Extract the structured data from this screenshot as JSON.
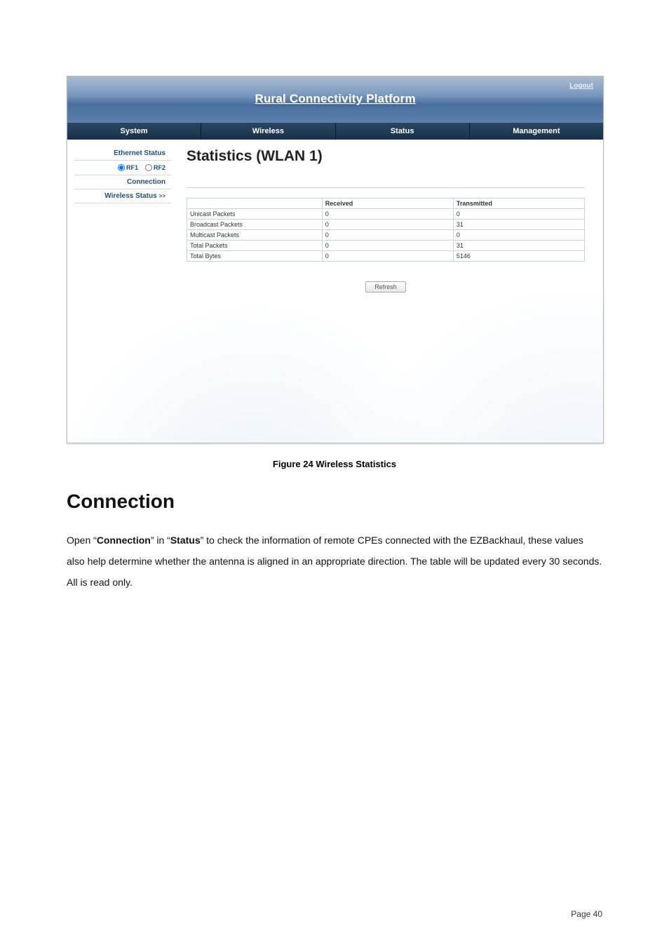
{
  "banner": {
    "title": "Rural Connectivity Platform",
    "logout": "Logout"
  },
  "tabs": {
    "system": "System",
    "wireless": "Wireless",
    "status": "Status",
    "management": "Management"
  },
  "sidebar": {
    "ethernet_status": "Ethernet Status",
    "rf1": "RF1",
    "rf2": "RF2",
    "connection": "Connection",
    "wireless_status": "Wireless Status"
  },
  "main": {
    "title": "Statistics (WLAN 1)",
    "headers": {
      "blank": "",
      "received": "Received",
      "transmitted": "Transmitted"
    },
    "rows": [
      {
        "label": "Unicast Packets",
        "received": "0",
        "transmitted": "0"
      },
      {
        "label": "Broadcast Packets",
        "received": "0",
        "transmitted": "31"
      },
      {
        "label": "Multicast Packets",
        "received": "0",
        "transmitted": "0"
      },
      {
        "label": "Total Packets",
        "received": "0",
        "transmitted": "31"
      },
      {
        "label": "Total Bytes",
        "received": "0",
        "transmitted": "5146"
      }
    ],
    "refresh": "Refresh"
  },
  "figure_caption": "Figure 24 Wireless Statistics",
  "section_title": "Connection",
  "paragraph": {
    "p1a": "Open “",
    "p1b": "Connection",
    "p1c": "” in “",
    "p1d": "Status",
    "p1e": "” to check the information of remote CPEs connected with the EZBackhaul, these values also help determine whether the antenna is aligned in an appropriate direction. The table will be updated every 30 seconds. All is read only."
  },
  "footer": "Page 40"
}
